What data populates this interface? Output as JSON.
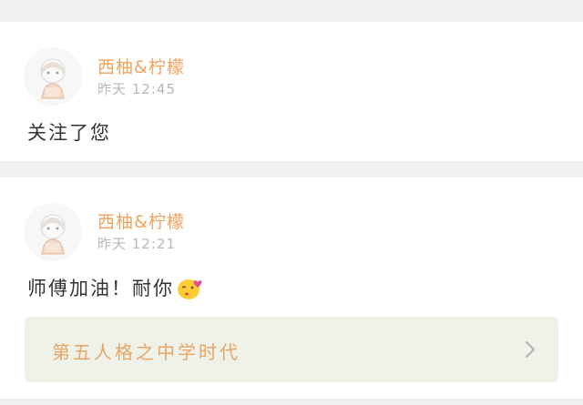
{
  "posts": [
    {
      "username": "西柚&柠檬",
      "time": "昨天 12:45",
      "content": "关注了您"
    },
    {
      "username": "西柚&柠檬",
      "time": "昨天 12:21",
      "content": "师傅加油！耐你",
      "emoji": "kiss-emoji",
      "link": {
        "title": "第五人格之中学时代",
        "icon": "chevron-right-icon"
      }
    }
  ],
  "colors": {
    "username": "#f0a35c",
    "time": "#b8b8b8",
    "link_bg": "#eef2e8",
    "link_text": "#e8a566"
  }
}
